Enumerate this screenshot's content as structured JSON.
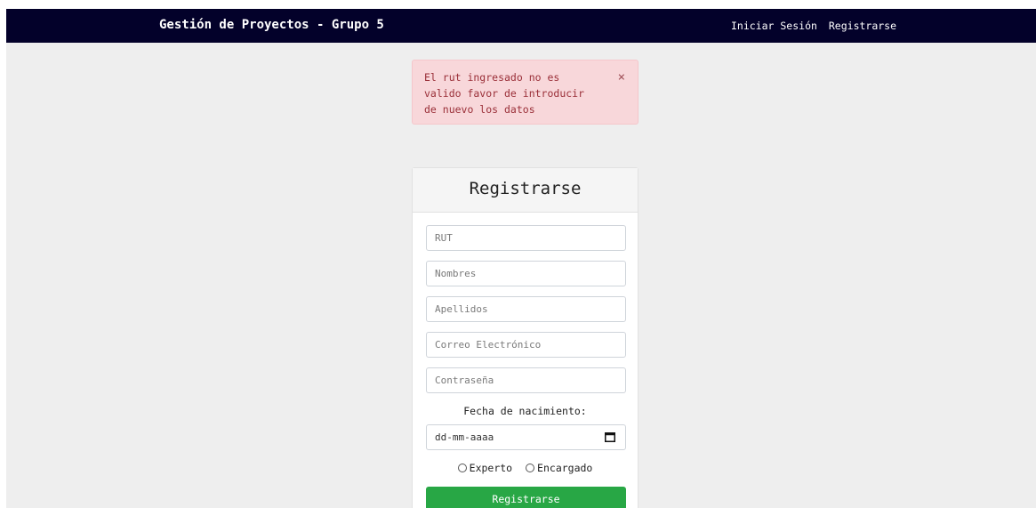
{
  "navbar": {
    "brand": "Gestión de Proyectos - Grupo 5",
    "links": [
      "Iniciar Sesión",
      "Registrarse"
    ]
  },
  "alert": {
    "message": "El rut ingresado no es valido favor de introducir de nuevo los datos",
    "close_symbol": "×"
  },
  "form": {
    "title": "Registrarse",
    "fields": {
      "rut": "RUT",
      "nombres": "Nombres",
      "apellidos": "Apellidos",
      "correo": "Correo Electrónico",
      "contrasena": "Contraseña"
    },
    "date_label": "Fecha de nacimiento:",
    "date_placeholder": "dd-mm-aaaa",
    "radio_options": [
      "Experto",
      "Encargado"
    ],
    "submit_label": "Registrarse"
  },
  "colors": {
    "navbar_bg": "#03012a",
    "alert_bg": "#f8d7da",
    "alert_text": "#9a2f38",
    "submit_bg": "#28a745",
    "page_bg": "#eeeeee"
  },
  "icons": {
    "calendar": "calendar-icon",
    "close": "close-icon"
  }
}
